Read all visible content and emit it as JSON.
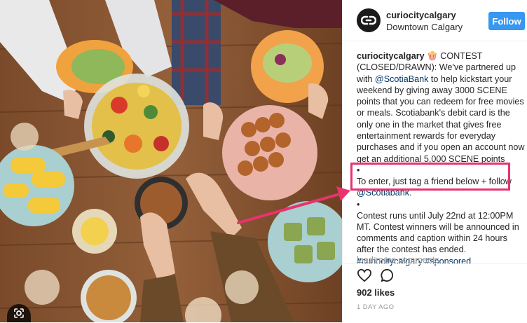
{
  "post": {
    "username": "curiocitycalgary",
    "location": "Downtown Calgary",
    "follow_label": "Follow",
    "caption": {
      "username": "curiocitycalgary",
      "part1": " 🍿 CONTEST (CLOSED/DRAWN): We've partnered up with ",
      "mention1": "@ScotiaBank",
      "part2": " to help kickstart your weekend by giving away 3000 SCENE points that you can redeem for free movies or meals. Scotiabank's debit card is the only one in the market that gives free entertainment rewards for everyday purchases and if you open an account now get an additional 5,000 SCENE points",
      "bullet1": "•",
      "enter_text": "To enter, just tag a friend below + follow ",
      "mention2": "@Scotiabank",
      "enter_end": ".",
      "bullet2": "•",
      "part3": "Contest runs until July 22nd at 12:00PM MT. Contest winners will be announced in comments and caption within 24 hours after the contest has ended. ",
      "hashtag1": "#curiocitycalgary",
      "hashtag2": "#sponsored"
    },
    "load_more": "load more comments",
    "likes": "902 likes",
    "timestamp": "1 DAY AGO"
  },
  "icons": {
    "avatar": "curiocity-logo-icon",
    "like": "heart-icon",
    "comment": "comment-bubble-icon",
    "image_search": "lens-icon"
  },
  "colors": {
    "follow_button": "#3897f0",
    "highlight": "#e8336e",
    "link": "#003569"
  }
}
